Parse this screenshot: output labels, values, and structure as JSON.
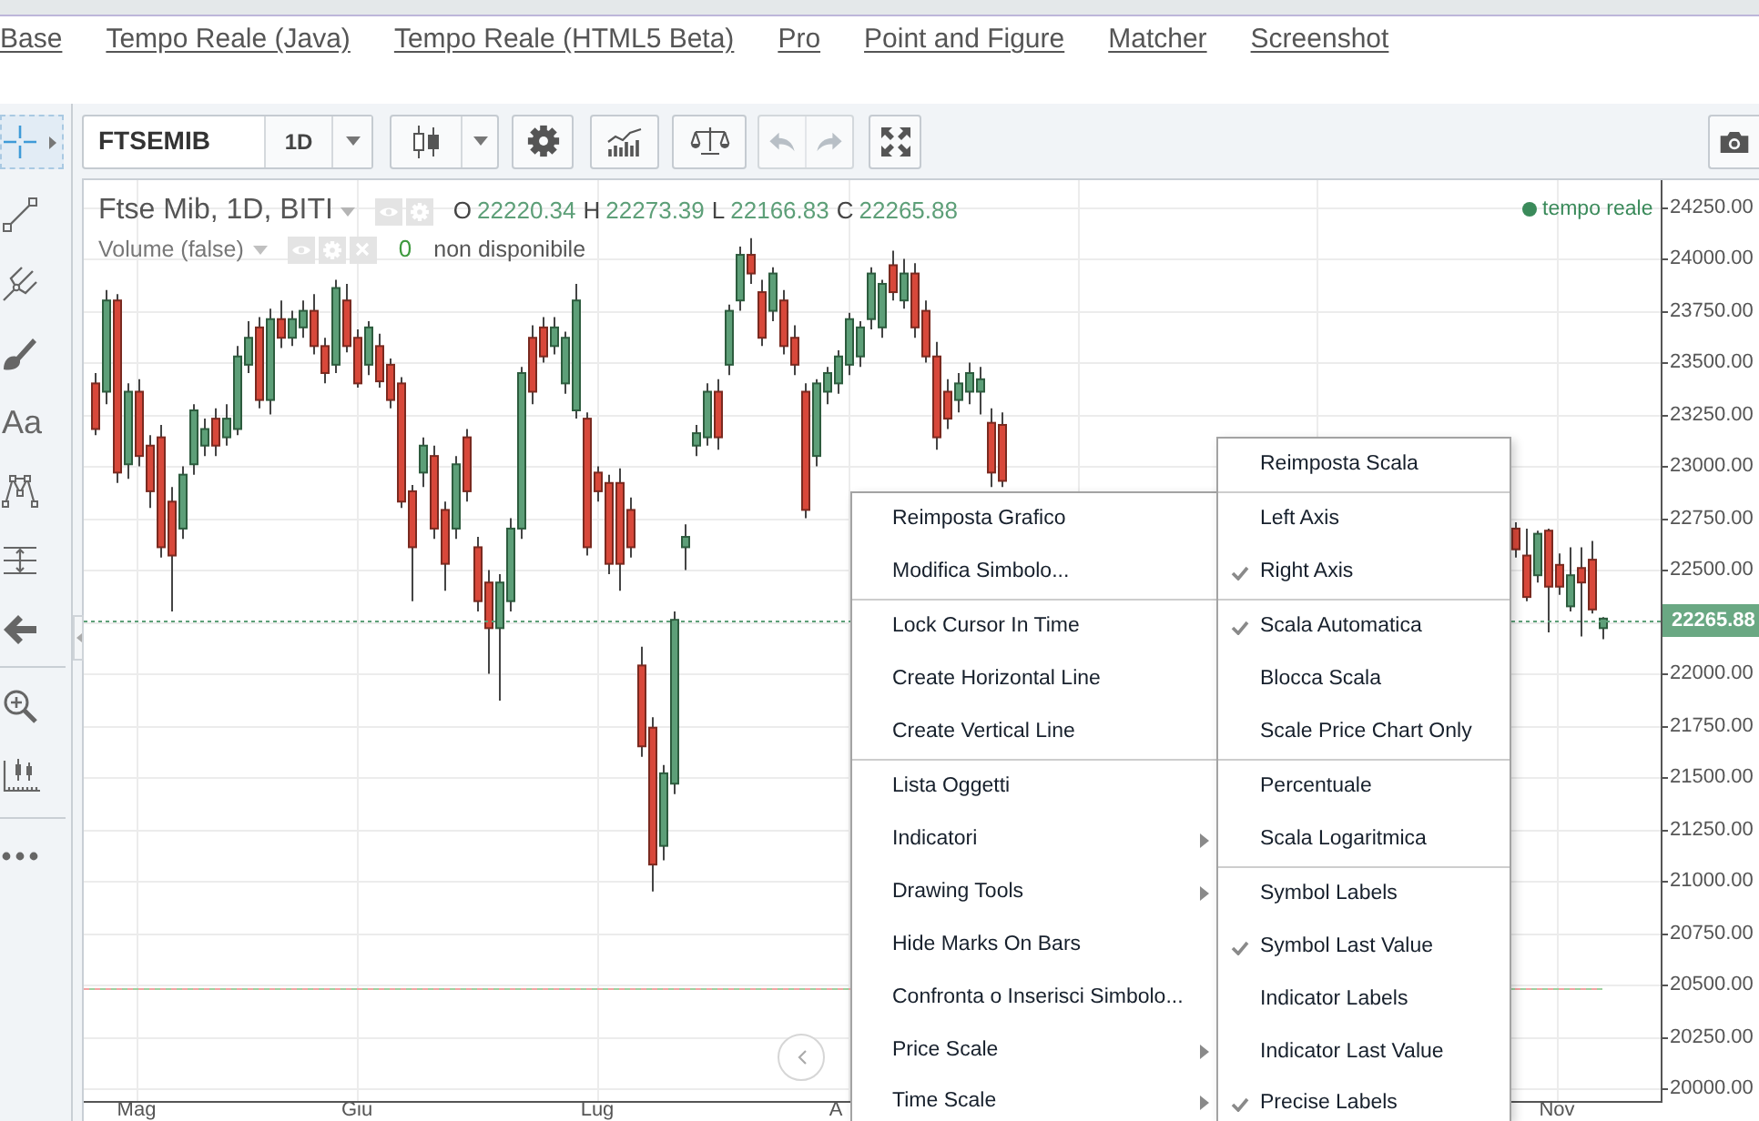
{
  "top_nav": {
    "links": [
      "Base",
      "Tempo Reale (Java)",
      "Tempo Reale (HTML5 Beta)",
      "Pro",
      "Point and Figure",
      "Matcher",
      "Screenshot"
    ]
  },
  "toolbar": {
    "symbol": "FTSEMIB",
    "interval": "1D",
    "history": [
      {
        "kind": "undo",
        "disabled": true
      },
      {
        "kind": "redo",
        "disabled": true
      }
    ]
  },
  "drawing_tools": [
    [
      {
        "kind": "crosshair",
        "selected": true,
        "flyout": true
      },
      {
        "kind": "trend-line",
        "selected": false,
        "flyout": false
      },
      {
        "kind": "pitchfork",
        "selected": false,
        "flyout": false
      },
      {
        "kind": "brush",
        "selected": false,
        "flyout": false
      },
      {
        "kind": "text",
        "label": "Aa",
        "selected": false,
        "flyout": false
      },
      {
        "kind": "pattern",
        "selected": false,
        "flyout": false
      },
      {
        "kind": "measure",
        "selected": false,
        "flyout": false
      },
      {
        "kind": "arrow",
        "selected": false,
        "flyout": false
      }
    ],
    [
      {
        "kind": "zoom",
        "selected": false,
        "flyout": false
      },
      {
        "kind": "ruler",
        "selected": false,
        "flyout": false
      }
    ],
    [
      {
        "kind": "more",
        "selected": false,
        "flyout": false
      }
    ]
  ],
  "chart": {
    "legend": {
      "title": "Ftse Mib, 1D, BITI",
      "ohlc": [
        {
          "key": "O",
          "value": "22220.34"
        },
        {
          "key": "H",
          "value": "22273.39"
        },
        {
          "key": "L",
          "value": "22166.83"
        },
        {
          "key": "C",
          "value": "22265.88"
        }
      ]
    },
    "volume": {
      "title": "Volume (false)",
      "value": "0",
      "status": "non disponibile"
    },
    "realtime": "tempo reale",
    "last_value": "22265.88",
    "time_axis": {
      "labels": [
        "Mag",
        "Giu",
        "Lug",
        "A",
        "Nov"
      ]
    },
    "chart_data": {
      "type": "candlestick",
      "grid": true,
      "ylim": [
        19940,
        24380
      ],
      "yticks": [
        {
          "value": 24250,
          "label": "24250.00"
        },
        {
          "value": 24000,
          "label": "24000.00"
        },
        {
          "value": 23750,
          "label": "23750.00"
        },
        {
          "value": 23500,
          "label": "23500.00"
        },
        {
          "value": 23250,
          "label": "23250.00"
        },
        {
          "value": 23000,
          "label": "23000.00"
        },
        {
          "value": 22750,
          "label": "22750.00"
        },
        {
          "value": 22500,
          "label": "22500.00"
        },
        {
          "value": 22000,
          "label": "22000.00"
        },
        {
          "value": 21750,
          "label": "21750.00"
        },
        {
          "value": 21500,
          "label": "21500.00"
        },
        {
          "value": 21250,
          "label": "21250.00"
        },
        {
          "value": 21000,
          "label": "21000.00"
        },
        {
          "value": 20750,
          "label": "20750.00"
        },
        {
          "value": 20500,
          "label": "20500.00"
        },
        {
          "value": 20250,
          "label": "20250.00"
        },
        {
          "value": 20000,
          "label": "20000.00"
        }
      ],
      "ohlc": [
        [
          23400,
          23450,
          23150,
          23180
        ],
        [
          23360,
          23850,
          23300,
          23800
        ],
        [
          23800,
          23830,
          22920,
          22970
        ],
        [
          23010,
          23400,
          22940,
          23360
        ],
        [
          23360,
          23420,
          23000,
          23050
        ],
        [
          23100,
          23150,
          22800,
          22880
        ],
        [
          23140,
          23200,
          22560,
          22610
        ],
        [
          22830,
          22900,
          22300,
          22570
        ],
        [
          22700,
          23000,
          22650,
          22960
        ],
        [
          23010,
          23300,
          22960,
          23270
        ],
        [
          23100,
          23230,
          23050,
          23180
        ],
        [
          23230,
          23280,
          23050,
          23100
        ],
        [
          23140,
          23300,
          23100,
          23230
        ],
        [
          23180,
          23580,
          23150,
          23530
        ],
        [
          23490,
          23700,
          23450,
          23620
        ],
        [
          23670,
          23720,
          23280,
          23320
        ],
        [
          23320,
          23760,
          23250,
          23710
        ],
        [
          23710,
          23800,
          23570,
          23620
        ],
        [
          23620,
          23750,
          23580,
          23710
        ],
        [
          23670,
          23800,
          23620,
          23750
        ],
        [
          23750,
          23830,
          23540,
          23580
        ],
        [
          23580,
          23620,
          23400,
          23450
        ],
        [
          23490,
          23900,
          23450,
          23860
        ],
        [
          23800,
          23880,
          23550,
          23580
        ],
        [
          23620,
          23660,
          23380,
          23400
        ],
        [
          23490,
          23700,
          23440,
          23670
        ],
        [
          23580,
          23640,
          23380,
          23410
        ],
        [
          23490,
          23520,
          23280,
          23320
        ],
        [
          23400,
          23430,
          22800,
          22830
        ],
        [
          22880,
          22910,
          22350,
          22610
        ],
        [
          22970,
          23140,
          22900,
          23100
        ],
        [
          23050,
          23100,
          22650,
          22700
        ],
        [
          22790,
          22830,
          22400,
          22530
        ],
        [
          22700,
          23050,
          22650,
          23010
        ],
        [
          23140,
          23180,
          22830,
          22880
        ],
        [
          22610,
          22660,
          22300,
          22350
        ],
        [
          22440,
          22500,
          22000,
          22220
        ],
        [
          22220,
          22480,
          21870,
          22440
        ],
        [
          22350,
          22750,
          22300,
          22700
        ],
        [
          22700,
          23480,
          22650,
          23450
        ],
        [
          23620,
          23680,
          23300,
          23360
        ],
        [
          23670,
          23720,
          23500,
          23530
        ],
        [
          23580,
          23720,
          23540,
          23670
        ],
        [
          23400,
          23650,
          23350,
          23620
        ],
        [
          23270,
          23880,
          23230,
          23800
        ],
        [
          23230,
          23260,
          22570,
          22610
        ],
        [
          22970,
          23000,
          22830,
          22880
        ],
        [
          22920,
          22960,
          22480,
          22530
        ],
        [
          22920,
          22990,
          22400,
          22530
        ],
        [
          22790,
          22850,
          22560,
          22610
        ],
        [
          22040,
          22130,
          21600,
          21650
        ],
        [
          21740,
          21790,
          20950,
          21080
        ],
        [
          21170,
          21560,
          21100,
          21520
        ],
        [
          21470,
          22300,
          21420,
          22260
        ],
        [
          22610,
          22720,
          22500,
          22660
        ],
        [
          23100,
          23200,
          23050,
          23160
        ],
        [
          23140,
          23400,
          23100,
          23360
        ],
        [
          23360,
          23420,
          23080,
          23140
        ],
        [
          23490,
          23780,
          23440,
          23750
        ],
        [
          23800,
          24060,
          23750,
          24020
        ],
        [
          24020,
          24100,
          23880,
          23930
        ],
        [
          23840,
          23900,
          23580,
          23620
        ],
        [
          23750,
          23960,
          23700,
          23930
        ],
        [
          23800,
          23850,
          23540,
          23580
        ],
        [
          23620,
          23680,
          23440,
          23490
        ],
        [
          23360,
          23400,
          22750,
          22790
        ],
        [
          23050,
          23420,
          23000,
          23400
        ],
        [
          23360,
          23480,
          23300,
          23450
        ],
        [
          23400,
          23560,
          23350,
          23530
        ],
        [
          23490,
          23740,
          23440,
          23710
        ],
        [
          23530,
          23700,
          23480,
          23670
        ],
        [
          23710,
          23960,
          23660,
          23930
        ],
        [
          23670,
          23900,
          23620,
          23880
        ],
        [
          23970,
          24040,
          23800,
          23840
        ],
        [
          23800,
          24000,
          23760,
          23930
        ],
        [
          23930,
          23980,
          23620,
          23670
        ],
        [
          23750,
          23800,
          23500,
          23530
        ],
        [
          23530,
          23600,
          23080,
          23140
        ],
        [
          23360,
          23420,
          23180,
          23230
        ],
        [
          23320,
          23450,
          23260,
          23400
        ],
        [
          23360,
          23500,
          23300,
          23450
        ],
        [
          23360,
          23480,
          23250,
          23420
        ],
        [
          23210,
          23280,
          22900,
          22970
        ],
        [
          23200,
          23260,
          22900,
          22930
        ],
        null,
        null,
        null,
        null,
        null,
        null,
        null,
        null,
        null,
        null,
        null,
        null,
        null,
        null,
        null,
        null,
        null,
        null,
        null,
        null,
        null,
        null,
        null,
        null,
        null,
        null,
        null,
        null,
        null,
        null,
        null,
        null,
        null,
        null,
        null,
        null,
        null,
        null,
        null,
        null,
        null,
        null,
        null,
        null,
        null,
        null,
        [
          22700,
          22730,
          22560,
          22600
        ],
        [
          22570,
          22700,
          22350,
          22370
        ],
        [
          22475,
          22690,
          22440,
          22675
        ],
        [
          22690,
          22700,
          22200,
          22420
        ],
        [
          22525,
          22580,
          22380,
          22420
        ],
        [
          22325,
          22610,
          22300,
          22475
        ],
        [
          22510,
          22610,
          22180,
          22440
        ],
        [
          22550,
          22640,
          22290,
          22310
        ],
        [
          22220,
          22273,
          22167,
          22266
        ]
      ]
    }
  },
  "context_menu": {
    "groups": [
      [
        {
          "label": "Reimposta Grafico",
          "submenu": false
        },
        {
          "label": "Modifica Simbolo...",
          "submenu": false
        }
      ],
      [
        {
          "label": "Lock Cursor In Time",
          "submenu": false
        },
        {
          "label": "Create Horizontal Line",
          "submenu": false
        },
        {
          "label": "Create Vertical Line",
          "submenu": false
        }
      ],
      [
        {
          "label": "Lista Oggetti",
          "submenu": false
        },
        {
          "label": "Indicatori",
          "submenu": true
        },
        {
          "label": "Drawing Tools",
          "submenu": true
        },
        {
          "label": "Hide Marks On Bars",
          "submenu": false
        },
        {
          "label": "Confronta o Inserisci Simbolo...",
          "submenu": false
        },
        {
          "label": "Price Scale",
          "submenu": true
        },
        {
          "label": "Time Scale",
          "submenu": true
        }
      ]
    ]
  },
  "scale_menu": {
    "groups": [
      [
        {
          "label": "Reimposta Scala",
          "checked": false
        }
      ],
      [
        {
          "label": "Left Axis",
          "checked": false
        },
        {
          "label": "Right Axis",
          "checked": true
        }
      ],
      [
        {
          "label": "Scala Automatica",
          "checked": true
        },
        {
          "label": "Blocca Scala",
          "checked": false
        },
        {
          "label": "Scale Price Chart Only",
          "checked": false
        }
      ],
      [
        {
          "label": "Percentuale",
          "checked": false
        },
        {
          "label": "Scala Logaritmica",
          "checked": false
        }
      ],
      [
        {
          "label": "Symbol Labels",
          "checked": false
        },
        {
          "label": "Symbol Last Value",
          "checked": true
        },
        {
          "label": "Indicator Labels",
          "checked": false
        },
        {
          "label": "Indicator Last Value",
          "checked": false
        },
        {
          "label": "Precise Labels",
          "checked": true
        }
      ]
    ]
  }
}
